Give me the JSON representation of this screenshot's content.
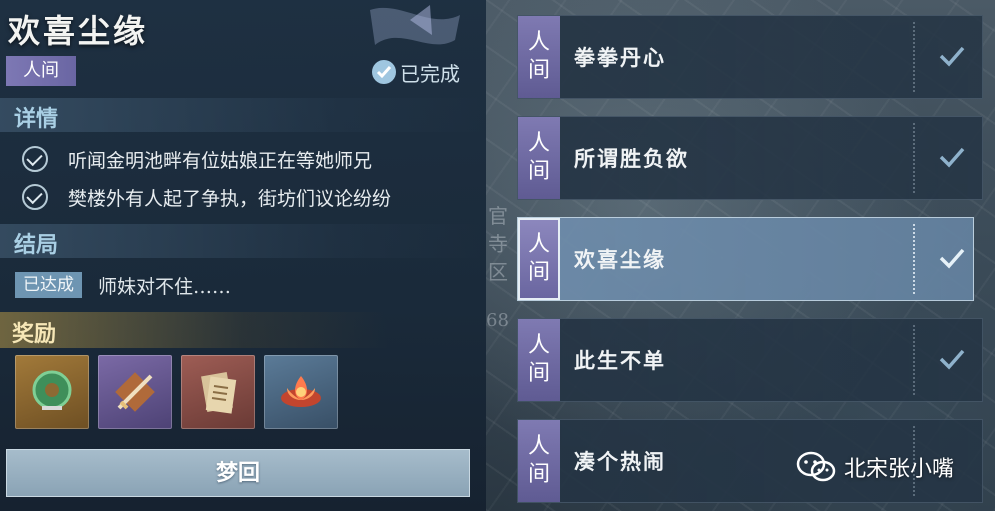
{
  "quest": {
    "title": "欢喜尘缘",
    "category": "人间",
    "status": "已完成"
  },
  "details": {
    "heading": "详情",
    "items": [
      "听闻金明池畔有位姑娘正在等她师兄",
      "樊楼外有人起了争执，街坊们议论纷纷"
    ]
  },
  "ending": {
    "heading": "结局",
    "badge": "已达成",
    "text": "师妹对不住……"
  },
  "rewards": {
    "heading": "奖励",
    "items": [
      {
        "icon": "jade-pendant-icon",
        "rarity": "gold"
      },
      {
        "icon": "sword-token-icon",
        "rarity": "purple"
      },
      {
        "icon": "scroll-letter-icon",
        "rarity": "red"
      },
      {
        "icon": "lotus-lantern-icon",
        "rarity": "blue"
      }
    ]
  },
  "action_button": "梦回",
  "quest_list": [
    {
      "tag_top": "人",
      "tag_bottom": "间",
      "name": "拳拳丹心",
      "completed": true
    },
    {
      "tag_top": "人",
      "tag_bottom": "间",
      "name": "所谓胜负欲",
      "completed": true
    },
    {
      "tag_top": "人",
      "tag_bottom": "间",
      "name": "欢喜尘缘",
      "completed": true,
      "selected": true
    },
    {
      "tag_top": "人",
      "tag_bottom": "间",
      "name": "此生不单",
      "completed": true
    },
    {
      "tag_top": "人",
      "tag_bottom": "间",
      "name": "凑个热闹",
      "completed": true
    }
  ],
  "watermark": "北宋张小嘴",
  "map_labels": [
    "官",
    "寺",
    "区",
    "68"
  ],
  "colors": {
    "tag_purple": "#7f7ab2",
    "accent_blue": "#a9cfe4",
    "reward_gold": "#f6e7b6",
    "button": "#9bb2c3"
  }
}
